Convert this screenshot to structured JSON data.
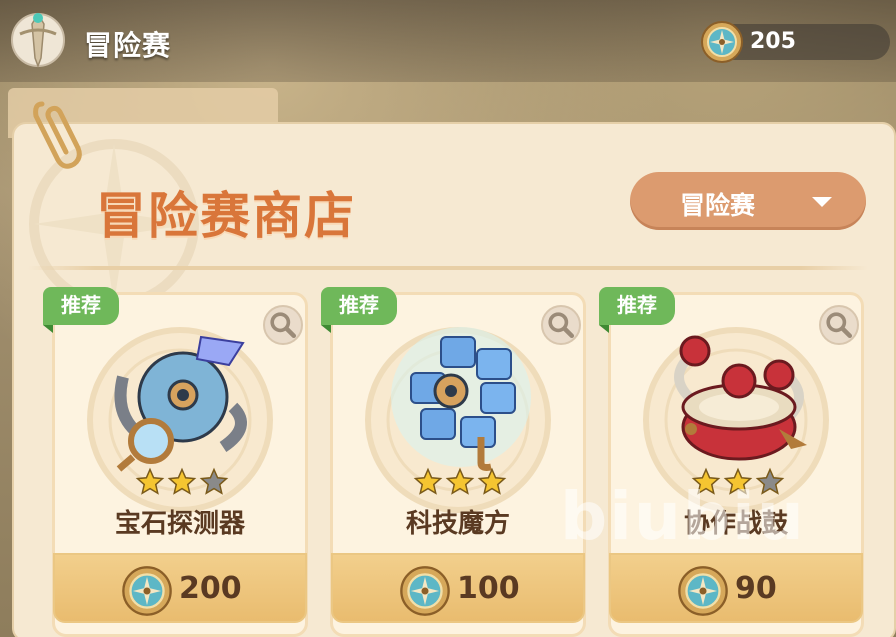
{
  "header": {
    "title": "冒险赛",
    "emblem_icon": "sword-emblem-icon",
    "currency": {
      "icon": "compass-coin-icon",
      "value": "205"
    }
  },
  "shop": {
    "title": "冒险赛商店",
    "dropdown": {
      "selected": "冒险赛",
      "icon": "caret-down-icon"
    }
  },
  "items": [
    {
      "tag": "推荐",
      "name": "宝石探测器",
      "stars_filled": 2,
      "stars_total": 3,
      "price": "200",
      "icon": "gem-detector-icon"
    },
    {
      "tag": "推荐",
      "name": "科技魔方",
      "stars_filled": 3,
      "stars_total": 3,
      "price": "100",
      "icon": "tech-cube-icon"
    },
    {
      "tag": "推荐",
      "name": "协作战鼓",
      "stars_filled": 2,
      "stars_total": 3,
      "price": "90",
      "icon": "war-drum-icon"
    }
  ],
  "watermark": "biubiu",
  "colors": {
    "title_orange": "#d9763a",
    "dropdown_bg": "#dc9b6f",
    "tag_green": "#6fb85a",
    "price_bar": "#f2cf8c",
    "star_yellow": "#f5c531",
    "star_empty": "#8a8a8a"
  }
}
